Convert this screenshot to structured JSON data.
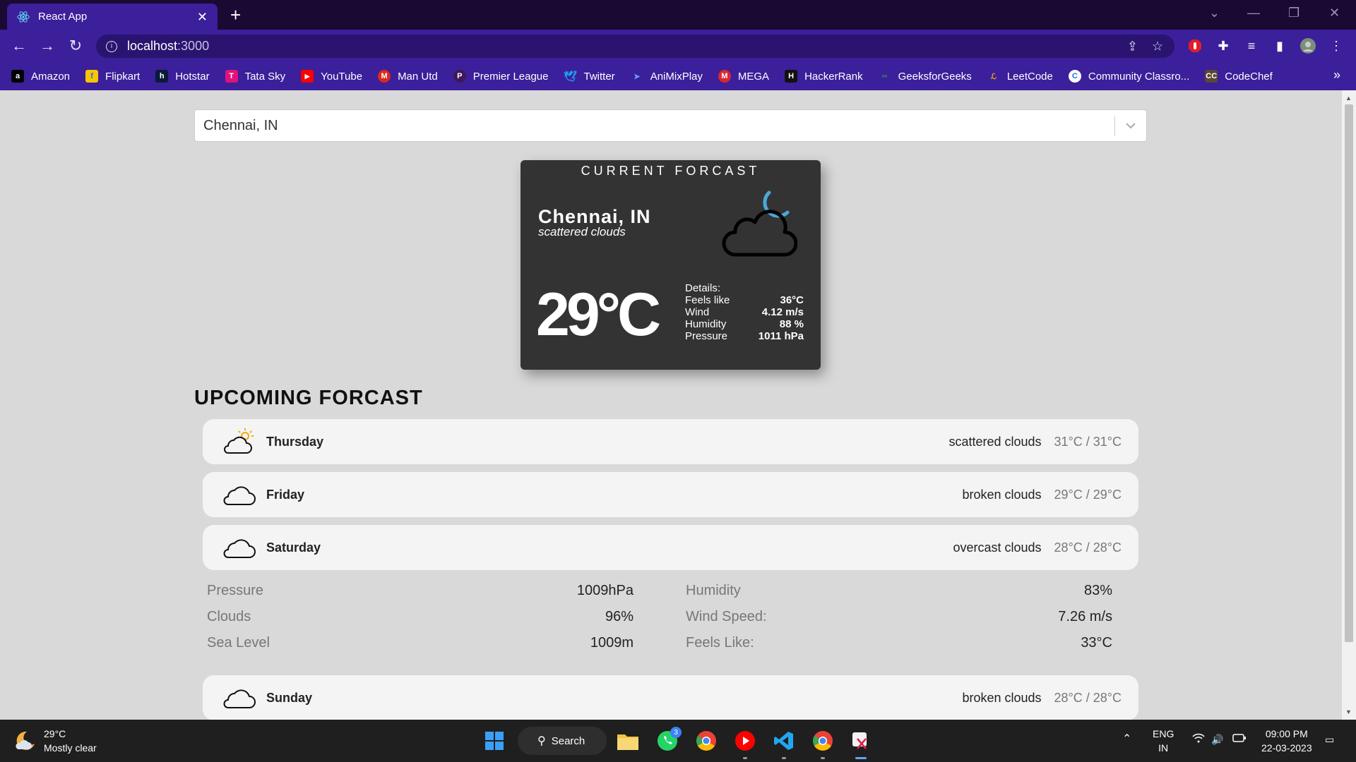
{
  "browser": {
    "tab_title": "React App",
    "url_host": "localhost",
    "url_port": ":3000",
    "bookmarks": [
      {
        "label": "Amazon",
        "color": "#000000",
        "glyph": "a"
      },
      {
        "label": "Flipkart",
        "color": "#f7c600",
        "glyph": "f"
      },
      {
        "label": "Hotstar",
        "color": "#0b1a3a",
        "glyph": "h"
      },
      {
        "label": "Tata Sky",
        "color": "#e0127a",
        "glyph": "T"
      },
      {
        "label": "YouTube",
        "color": "#ff0000",
        "glyph": "▶"
      },
      {
        "label": "Man Utd",
        "color": "#da291c",
        "glyph": "M"
      },
      {
        "label": "Premier League",
        "color": "#3d195b",
        "glyph": "P"
      },
      {
        "label": "Twitter",
        "color": "#1da1f2",
        "glyph": "t"
      },
      {
        "label": "AniMixPlay",
        "color": "#2563eb",
        "glyph": "A"
      },
      {
        "label": "MEGA",
        "color": "#d9272e",
        "glyph": "M"
      },
      {
        "label": "HackerRank",
        "color": "#111111",
        "glyph": "H"
      },
      {
        "label": "GeeksforGeeks",
        "color": "#2f8d46",
        "glyph": "G"
      },
      {
        "label": "LeetCode",
        "color": "#ffa116",
        "glyph": "L"
      },
      {
        "label": "Community Classro...",
        "color": "#1a73e8",
        "glyph": "C"
      },
      {
        "label": "CodeChef",
        "color": "#5b4638",
        "glyph": "C"
      }
    ]
  },
  "search": {
    "value": "Chennai, IN"
  },
  "current": {
    "heading": "CURRENT FORCAST",
    "city": "Chennai, IN",
    "description": "scattered clouds",
    "temperature": "29°C",
    "details_label": "Details:",
    "details": [
      {
        "label": "Feels like",
        "value": "36°C"
      },
      {
        "label": "Wind",
        "value": "4.12 m/s"
      },
      {
        "label": "Humidity",
        "value": "88 %"
      },
      {
        "label": "Pressure",
        "value": "1011 hPa"
      }
    ]
  },
  "upcoming": {
    "heading": "UPCOMING FORCAST",
    "days": [
      {
        "day": "Thursday",
        "description": "scattered clouds",
        "temps": "31°C / 31°C",
        "icon": "partly-sunny-icon"
      },
      {
        "day": "Friday",
        "description": "broken clouds",
        "temps": "29°C / 29°C",
        "icon": "cloud-icon"
      },
      {
        "day": "Saturday",
        "description": "overcast clouds",
        "temps": "28°C / 28°C",
        "icon": "cloud-icon"
      },
      {
        "day": "Sunday",
        "description": "broken clouds",
        "temps": "28°C / 28°C",
        "icon": "cloud-icon"
      }
    ],
    "expanded_details": {
      "left": [
        {
          "label": "Pressure",
          "value": "1009hPa"
        },
        {
          "label": "Clouds",
          "value": "96%"
        },
        {
          "label": "Sea Level",
          "value": "1009m"
        }
      ],
      "right": [
        {
          "label": "Humidity",
          "value": "83%"
        },
        {
          "label": "Wind Speed:",
          "value": "7.26 m/s"
        },
        {
          "label": "Feels Like:",
          "value": "33°C"
        }
      ]
    }
  },
  "taskbar": {
    "weather_temp": "29°C",
    "weather_desc": "Mostly clear",
    "search_label": "Search",
    "whatsapp_badge": "3",
    "lang_line1": "ENG",
    "lang_line2": "IN",
    "time": "09:00 PM",
    "date": "22-03-2023"
  }
}
